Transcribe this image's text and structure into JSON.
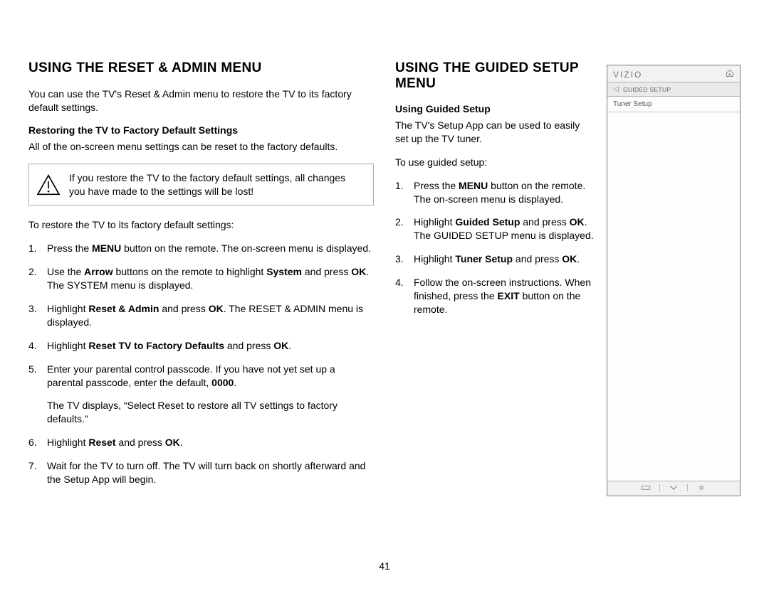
{
  "left": {
    "heading": "USING THE RESET & ADMIN MENU",
    "intro": "You can use the TV's Reset & Admin menu to restore the TV to its factory default settings.",
    "sub_heading": "Restoring the TV to Factory Default Settings",
    "sub_intro": "All of the on-screen menu settings can be reset to the factory defaults.",
    "warning": "If you restore the TV to the factory default settings, all changes you have made to the settings will be lost!",
    "restore_lead": "To restore the TV to its factory default settings:",
    "steps": {
      "s1a": "Press the ",
      "s1b": "MENU",
      "s1c": " button on the remote. The on-screen menu is displayed.",
      "s2a": "Use the ",
      "s2b": "Arrow",
      "s2c": " buttons on the remote to highlight ",
      "s2d": "System",
      "s2e": " and press ",
      "s2f": "OK",
      "s2g": ". The SYSTEM menu is displayed.",
      "s3a": "Highlight ",
      "s3b": "Reset & Admin",
      "s3c": " and press ",
      "s3d": "OK",
      "s3e": ". The RESET & ADMIN menu is displayed.",
      "s4a": "Highlight ",
      "s4b": "Reset TV to Factory Defaults",
      "s4c": " and press ",
      "s4d": "OK",
      "s4e": ".",
      "s5a": "Enter your parental control passcode. If you have not yet set up a parental passcode, enter the default, ",
      "s5b": "0000",
      "s5c": ".",
      "s5sub": "The TV displays, “Select Reset to restore all TV settings to factory defaults.”",
      "s6a": "Highlight ",
      "s6b": "Reset",
      "s6c": " and press ",
      "s6d": "OK",
      "s6e": ".",
      "s7": "Wait for the TV to turn off. The TV will turn back on shortly afterward and the Setup App will begin."
    }
  },
  "right": {
    "heading": "USING THE GUIDED SETUP MENU",
    "sub_heading": "Using Guided Setup",
    "intro": "The TV's Setup App can be used to easily set up the TV tuner.",
    "lead": "To use guided setup:",
    "steps": {
      "s1a": "Press the ",
      "s1b": "MENU",
      "s1c": " button on the remote. The on-screen menu is displayed.",
      "s2a": "Highlight ",
      "s2b": "Guided Setup",
      "s2c": " and press ",
      "s2d": "OK",
      "s2e": ". The GUIDED SETUP menu is displayed.",
      "s3a": "Highlight ",
      "s3b": "Tuner Setup",
      "s3c": " and press ",
      "s3d": "OK",
      "s3e": ".",
      "s4a": "Follow the on-screen instructions. When finished, press the ",
      "s4b": "EXIT",
      "s4c": " button on the remote."
    }
  },
  "tv": {
    "brand": "VIZIO",
    "breadcrumb": "GUIDED SETUP",
    "item1": "Tuner Setup"
  },
  "page_number": "41"
}
